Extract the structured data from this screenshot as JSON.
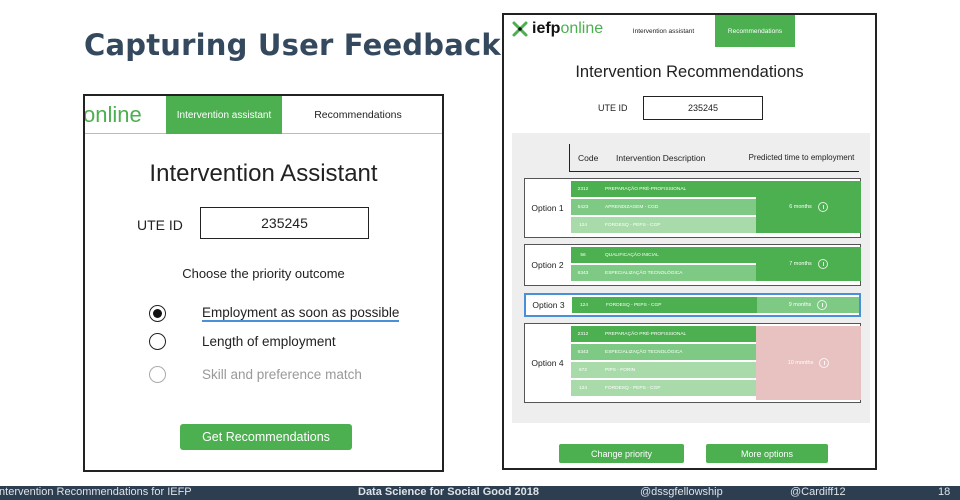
{
  "slide": {
    "title": "Capturing User Feedback"
  },
  "left": {
    "logo": "online",
    "tab_active": "Intervention assistant",
    "tab_other": "Recommendations",
    "heading": "Intervention Assistant",
    "ute_label": "UTE ID",
    "ute_value": "235245",
    "choose_label": "Choose the priority outcome",
    "options": [
      "Employment as soon as possible",
      "Length of employment",
      "Skill and preference match"
    ],
    "selected_option": 0,
    "button": "Get Recommendations"
  },
  "right": {
    "logo_bold": "iefp",
    "logo_light": "online",
    "tab_other": "Intervention assistant",
    "tab_active": "Recommendations",
    "heading": "Intervention Recommendations",
    "ute_label": "UTE ID",
    "ute_value": "235245",
    "columns": {
      "code": "Code",
      "description": "Intervention Description",
      "time": "Predicted time to employment"
    },
    "options": [
      {
        "label": "Option 1",
        "time": "6 months",
        "rows": [
          {
            "code": "2312",
            "desc": "PREPARAÇÃO PRÉ-PROFISSIONAL"
          },
          {
            "code": "5423",
            "desc": "APRENDIZAGEM - CGD"
          },
          {
            "code": "124",
            "desc": "FORDESQ - PEPS - CGP"
          }
        ]
      },
      {
        "label": "Option 2",
        "time": "7 months",
        "rows": [
          {
            "code": "56",
            "desc": "QUALIFICAÇÃO INICIAL"
          },
          {
            "code": "6343",
            "desc": "ESPECIALIZAÇÃO TECNOLÓGICA"
          }
        ]
      },
      {
        "label": "Option 3",
        "time": "9 months",
        "rows": [
          {
            "code": "124",
            "desc": "FORDESQ - PEPS - CGP"
          }
        ]
      },
      {
        "label": "Option 4",
        "time": "10 months",
        "rows": [
          {
            "code": "2312",
            "desc": "PREPARAÇÃO PRÉ-PROFISSIONAL"
          },
          {
            "code": "6343",
            "desc": "ESPECIALIZAÇÃO TECNOLÓGICA"
          },
          {
            "code": "672",
            "desc": "PIPS - FORIN"
          },
          {
            "code": "124",
            "desc": "FORDESQ - PEPS - CGP"
          }
        ]
      }
    ],
    "btn_change": "Change priority",
    "btn_more": "More options"
  },
  "footer": {
    "left": "Intervention Recommendations for IEFP",
    "center": "Data Science for Social Good 2018",
    "right1": "@dssgfellowship",
    "right2": "@Cardiff12",
    "page": "18"
  },
  "colors": {
    "green": "#4caf50",
    "green_mid": "#7ec983",
    "green_light": "#a8dba9",
    "pink": "#e8c1c1",
    "selection_blue": "#4a90d9",
    "title": "#34495e",
    "footer": "#2c3e50"
  }
}
